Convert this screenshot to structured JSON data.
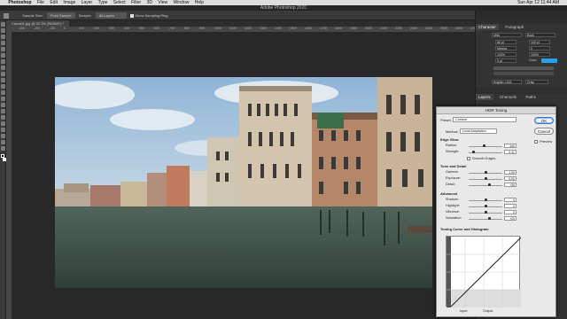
{
  "menubar": {
    "app": "Photoshop",
    "items": [
      "File",
      "Edit",
      "Image",
      "Layer",
      "Type",
      "Select",
      "Filter",
      "3D",
      "View",
      "Window",
      "Help"
    ],
    "clock": "Sun Apr 12  11:44 AM"
  },
  "window_title": "Adobe Photoshop 2020",
  "options": {
    "sample_size_label": "Sample Size:",
    "sample_size": "Point Sample",
    "sample_label": "Sample:",
    "sample": "All Layers",
    "ring_label": "Show Sampling Ring"
  },
  "doc_tab": "Canal01.jpg @ 33.3% (RGB/8*) *",
  "ruler_marks": [
    "-300",
    "-200",
    "-100",
    "0",
    "100",
    "200",
    "300",
    "400",
    "500",
    "600",
    "700",
    "800",
    "900",
    "1000",
    "1100",
    "1200",
    "1300",
    "1400",
    "1500",
    "1600",
    "1700",
    "1800",
    "1900",
    "2000",
    "2100",
    "2200",
    "2300",
    "2400",
    "2500",
    "2600",
    "2700"
  ],
  "right_panel": {
    "tabs": [
      "Character",
      "Paragraph"
    ],
    "font": "Ubik",
    "style": "Book",
    "size": "80 pt",
    "leading": "100 pt",
    "kerning": "Metrics",
    "tracking": "0",
    "vscale": "100%",
    "hscale": "100%",
    "baseline": "0 pt",
    "color_label": "Color:",
    "color_hex": "#29a0ee",
    "language": "English: USA",
    "aa": "Crisp",
    "layer_tabs": [
      "Layers",
      "Channels",
      "Paths"
    ]
  },
  "hdr": {
    "title": "HDR Toning",
    "preset_label": "Preset:",
    "preset": "Custom",
    "method_label": "Method:",
    "method": "Local Adaptation",
    "ok": "OK",
    "cancel": "Cancel",
    "preview": "Preview",
    "sections": {
      "edge": "Edge Glow",
      "tone": "Tone and Detail",
      "advanced": "Advanced",
      "curve": "Toning Curve and Histogram"
    },
    "sliders": [
      {
        "label": "Radius:",
        "value": "100",
        "unit": "px",
        "pos": 0.45
      },
      {
        "label": "Strength:",
        "value": "0.41",
        "unit": "",
        "pos": 0.1
      },
      {
        "label": "Gamma:",
        "value": "1.00",
        "unit": "",
        "pos": 0.5
      },
      {
        "label": "Exposure:",
        "value": "0.00",
        "unit": "",
        "pos": 0.5
      },
      {
        "label": "Detail:",
        "value": "+30",
        "unit": "%",
        "pos": 0.62
      },
      {
        "label": "Shadow:",
        "value": "0",
        "unit": "%",
        "pos": 0.5
      },
      {
        "label": "Highlight:",
        "value": "0",
        "unit": "%",
        "pos": 0.5
      },
      {
        "label": "Vibrance:",
        "value": "0",
        "unit": "%",
        "pos": 0.5
      },
      {
        "label": "Saturation:",
        "value": "+20",
        "unit": "%",
        "pos": 0.6
      }
    ],
    "smooth_edges": "Smooth Edges",
    "input_label": "Input:",
    "output_label": "Output:"
  }
}
